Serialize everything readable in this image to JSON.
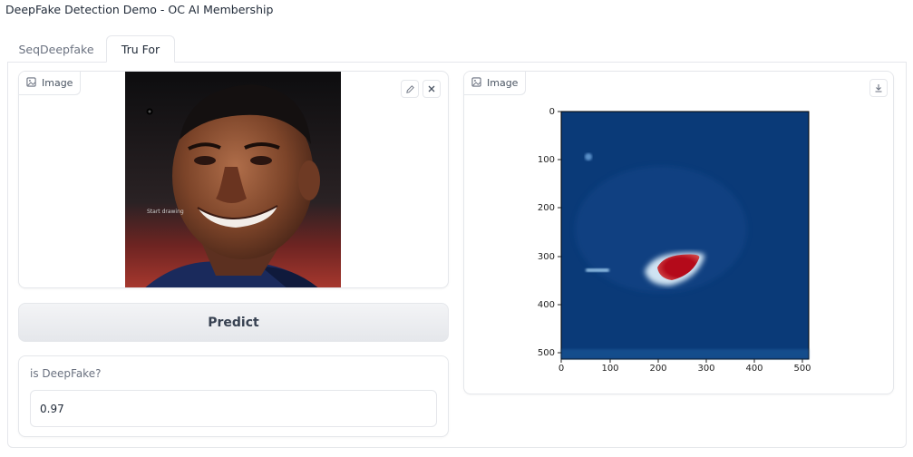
{
  "app": {
    "title": "DeepFake Detection Demo - OC AI Membership"
  },
  "tabs": [
    {
      "label": "SeqDeepfake",
      "active": false
    },
    {
      "label": "Tru For",
      "active": true
    }
  ],
  "input_image": {
    "label": "Image",
    "overlay_text": "Start drawing",
    "icons": [
      "image-icon",
      "edit-pencil-icon",
      "close-icon"
    ]
  },
  "predict_button": {
    "label": "Predict"
  },
  "output": {
    "label": "is DeepFake?",
    "value": "0.97"
  },
  "output_image": {
    "label": "Image",
    "icons": [
      "image-icon",
      "download-icon"
    ]
  },
  "heatmap": {
    "x_ticks": [
      "0",
      "100",
      "200",
      "300",
      "400",
      "500"
    ],
    "y_ticks": [
      "0",
      "100",
      "200",
      "300",
      "400",
      "500"
    ],
    "colors": {
      "background": "#0a3a78",
      "hot": "#b40a1a",
      "mid": "#9ec6e6"
    }
  }
}
